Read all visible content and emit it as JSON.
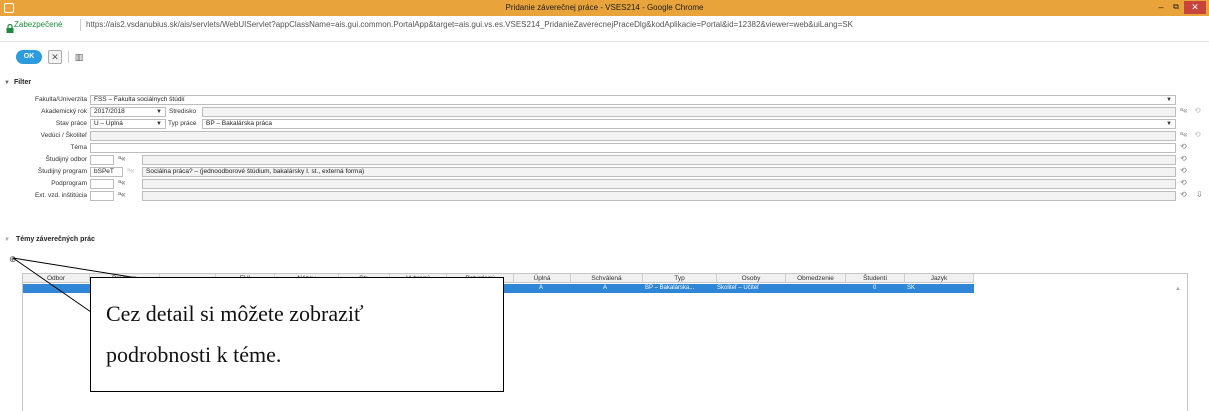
{
  "window": {
    "title": "Pridanie záverečnej práce - VSES214 - Google Chrome",
    "minimize": "–",
    "maximize": "⧉",
    "close": "✕"
  },
  "address": {
    "secure_label": "Zabezpečené",
    "url": "https://ais2.vsdanubius.sk/ais/servlets/WebUIServlet?appClassName=ais.gui.common.PortalApp&target=ais.gui.vs.es.VSES214_PridanieZaverecnejPraceDlg&kodAplikacie=Portal&id=12382&viewer=web&uiLang=SK"
  },
  "toolbar": {
    "ok_label": "OK",
    "cancel_glyph": "✕",
    "columns_glyph": "▥"
  },
  "filter": {
    "header": "Filter",
    "fakulta_label": "Fakulta/Univerzita",
    "fakulta_value": "FSS – Fakulta sociálnych štúdií",
    "rok_label": "Akademický rok",
    "rok_value": "2017/2018",
    "stredisko_label": "Stredisko",
    "stredisko_value": "",
    "stav_label": "Stav práce",
    "stav_value": "Ú – Úplná",
    "typ_label": "Typ práce",
    "typ_value": "BP – Bakalárska práca",
    "veduci_label": "Vedúci / Školiteľ",
    "veduci_value": "",
    "tema_label": "Téma",
    "tema_value": "",
    "odbor_label": "Študijný odbor",
    "odbor_value": "",
    "program_label": "Študijný program",
    "program_code": "bSPeT",
    "program_value": "Sociálna práca? – (jednoodborové štúdium, bakalársky I. st., externá forma)",
    "podprogram_label": "Podprogram",
    "podprogram_value": "",
    "institucia_label": "Ext. vzd. inštitúcia",
    "institucia_value": ""
  },
  "themes": {
    "header": "Témy záverečných prác",
    "columns": [
      "Odbor",
      "Program",
      "",
      "EVI",
      "Názov",
      "Str.",
      "Vybraný",
      "Potvrdený",
      "Úplná",
      "Schválená",
      "Typ",
      "Osoby",
      "Obmedzenie",
      "Študenti",
      "Jazyk"
    ],
    "row": {
      "uplna": "A",
      "schvalena": "A",
      "typ": "BP – Bakalárska...",
      "osoby": "Školiteľ – Učiteľ",
      "studenti": "0",
      "jazyk": "SK"
    }
  },
  "callout": {
    "line1": "Cez detail si môžete zobraziť",
    "line2": "podrobnosti k téme."
  },
  "icons": {
    "search_all": "ᵃ«",
    "reset": "⟲",
    "expand": "⇩",
    "zoom": "⊕",
    "dropdown": "▼",
    "collapse_arrow": "▼"
  },
  "colors": {
    "titlebar": "#e8a33a",
    "close": "#c8433a",
    "ok_button": "#2f9bdf",
    "selected_row": "#2f86d6",
    "secure_text": "#1e8b3c"
  }
}
